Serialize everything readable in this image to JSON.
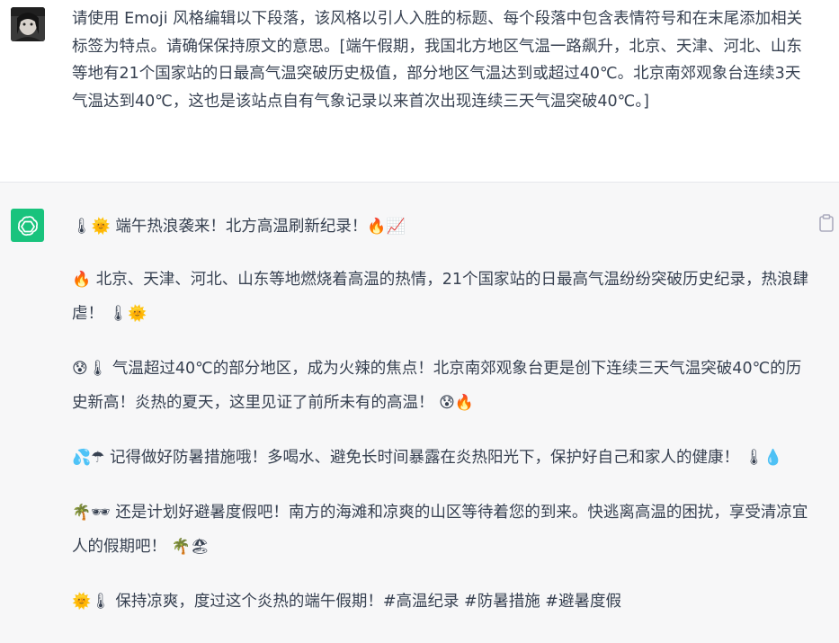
{
  "user": {
    "avatar_icon": "user-avatar-photo",
    "prompt": "请使用 Emoji 风格编辑以下段落，该风格以引人入胜的标题、每个段落中包含表情符号和在末尾添加相关标签为特点。请确保保持原文的意思。[端午假期，我国北方地区气温一路飙升，北京、天津、河北、山东等地有21个国家站的日最高气温突破历史极值，部分地区气温达到或超过40℃。北京南郊观象台连续3天气温达到40℃，这也是该站点自有气象记录以来首次出现连续三天气温突破40℃。]"
  },
  "assistant": {
    "avatar_icon": "chatgpt-logo-icon",
    "avatar_color": "#19c37d",
    "copy_icon": "clipboard-icon",
    "paragraphs": [
      {
        "lead_emoji": "🌡🌞",
        "text": "端午热浪袭来！北方高温刷新纪录！",
        "tail_emoji": "🔥📈"
      },
      {
        "lead_emoji": "🔥",
        "text": "北京、天津、河北、山东等地燃烧着高温的热情，21个国家站的日最高气温纷纷突破历史纪录，热浪肆虐！",
        "tail_emoji": "🌡🌞"
      },
      {
        "lead_emoji": "😰🌡",
        "text": "气温超过40℃的部分地区，成为火辣的焦点！北京南郊观象台更是创下连续三天气温突破40℃的历史新高！炎热的夏天，这里见证了前所未有的高温！",
        "tail_emoji": "😰🔥"
      },
      {
        "lead_emoji": "💦☂",
        "text": "记得做好防暑措施哦！多喝水、避免长时间暴露在炎热阳光下，保护好自己和家人的健康！",
        "tail_emoji": "🌡💧"
      },
      {
        "lead_emoji": "🌴🕶",
        "text": "还是计划好避暑度假吧！南方的海滩和凉爽的山区等待着您的到来。快逃离高温的困扰，享受清凉宜人的假期吧！",
        "tail_emoji": "🌴🏖"
      },
      {
        "lead_emoji": "🌞🌡",
        "text": "保持凉爽，度过这个炎热的端午假期！#高温纪录 #防暑措施 #避暑度假",
        "tail_emoji": ""
      }
    ]
  }
}
